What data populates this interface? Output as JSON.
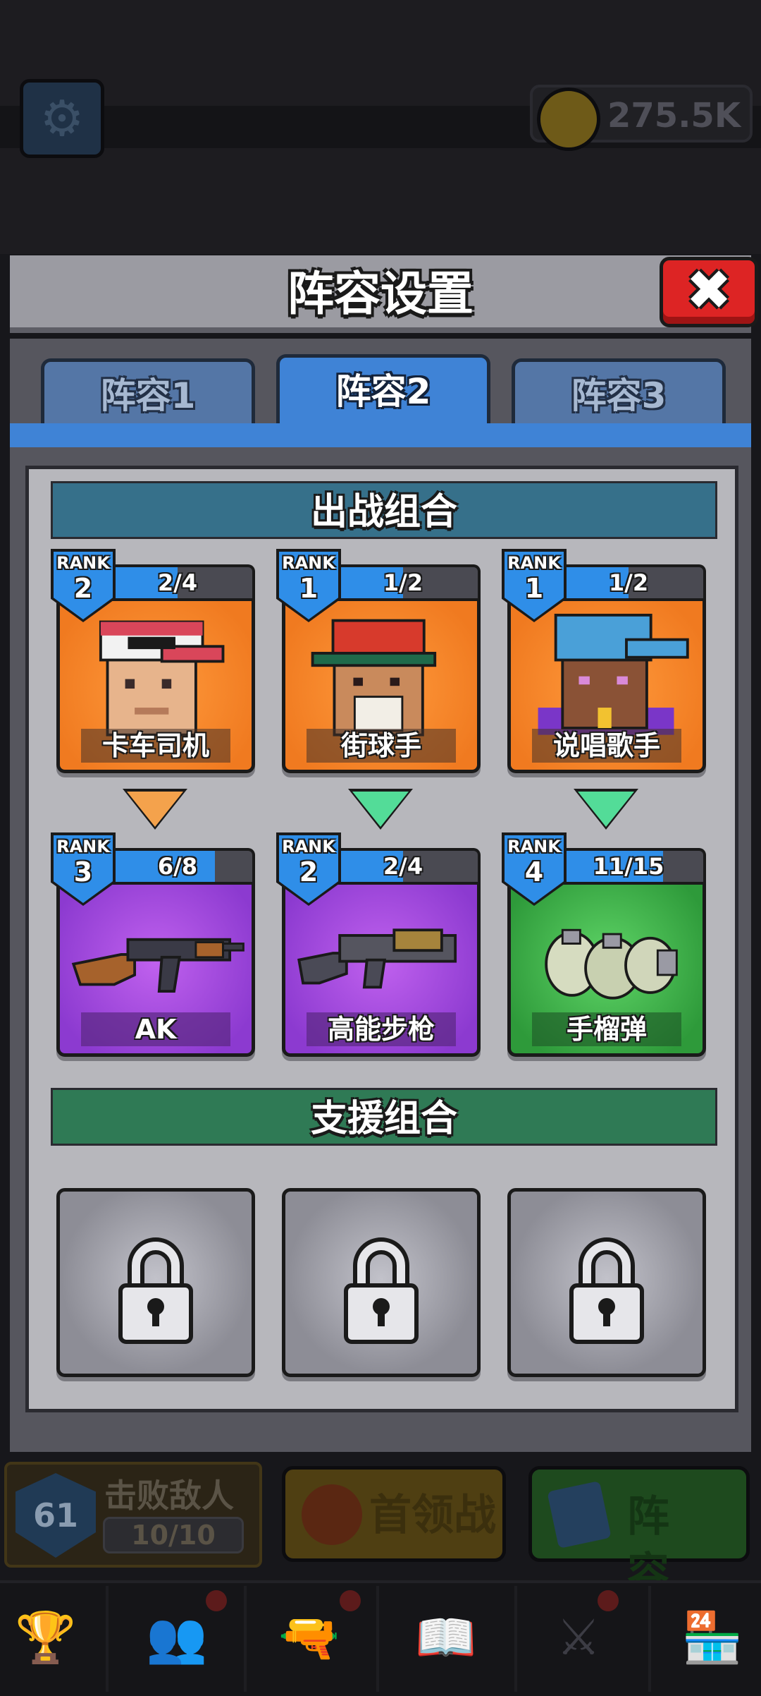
{
  "background": {
    "coins": "275.5K",
    "enemy": {
      "level": "61",
      "title": "击败敌人",
      "progress": "10/10"
    },
    "boss_button": "首领战",
    "lineup_button": "阵容"
  },
  "dialog": {
    "title": "阵容设置",
    "tabs": [
      "阵容1",
      "阵容2",
      "阵容3"
    ],
    "active_tab": "阵容2",
    "battle_section": "出战组合",
    "support_section": "支援组合",
    "rank_label": "RANK",
    "characters": [
      {
        "name": "卡车司机",
        "rank": "2",
        "progress": "2/4",
        "fill": 0.5,
        "bg": "orange"
      },
      {
        "name": "街球手",
        "rank": "1",
        "progress": "1/2",
        "fill": 0.5,
        "bg": "orange"
      },
      {
        "name": "说唱歌手",
        "rank": "1",
        "progress": "1/2",
        "fill": 0.5,
        "bg": "orange"
      }
    ],
    "weapons": [
      {
        "name": "AK",
        "rank": "3",
        "progress": "6/8",
        "fill": 0.75,
        "bg": "purple",
        "arrow": "orange"
      },
      {
        "name": "高能步枪",
        "rank": "2",
        "progress": "2/4",
        "fill": 0.5,
        "bg": "purple",
        "arrow": "green"
      },
      {
        "name": "手榴弹",
        "rank": "4",
        "progress": "11/15",
        "fill": 0.73,
        "bg": "green",
        "arrow": "green"
      }
    ],
    "support_slots": [
      "locked",
      "locked",
      "locked"
    ]
  },
  "colors": {
    "accent_blue": "#3f83d6",
    "close_red": "#dd2424",
    "section_blue": "#36708a",
    "section_green": "#2f7a55"
  }
}
